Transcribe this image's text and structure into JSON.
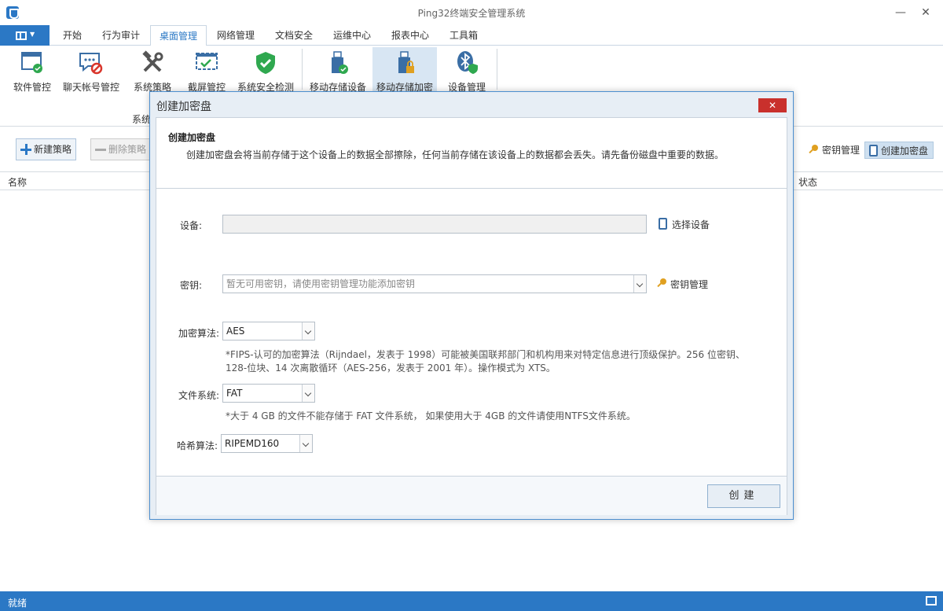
{
  "window": {
    "title": "Ping32终端安全管理系统"
  },
  "menu": {
    "tabs": [
      "开始",
      "行为审计",
      "桌面管理",
      "网络管理",
      "文档安全",
      "运维中心",
      "报表中心",
      "工具箱"
    ],
    "active_index": 2
  },
  "ribbon": {
    "buttons": [
      "软件管控",
      "聊天帐号管控",
      "系统策略",
      "截屏管控",
      "系统安全检测",
      "移动存储设备",
      "移动存储加密",
      "设备管理"
    ],
    "group_label": "系统"
  },
  "toolbar": {
    "new_policy": "新建策略",
    "delete_policy": "删除策略",
    "key_manage": "密钥管理",
    "create_encrypted_disk": "创建加密盘"
  },
  "table": {
    "columns": [
      "名称",
      "状态"
    ]
  },
  "status": {
    "text": "就绪"
  },
  "dialog": {
    "title": "创建加密盘",
    "close": "✕",
    "header_title": "创建加密盘",
    "header_desc": "创建加密盘会将当前存储于这个设备上的数据全部擦除，任何当前存储在该设备上的数据都会丢失。请先备份磁盘中重要的数据。",
    "device_label": "设备:",
    "device_value": "",
    "select_device": "选择设备",
    "key_label": "密钥:",
    "key_placeholder": "暂无可用密钥，请使用密钥管理功能添加密钥",
    "key_manage": "密钥管理",
    "algo_label": "加密算法:",
    "algo_value": "AES",
    "algo_note_1": "*FIPS-认可的加密算法（Rijndael，发表于 1998）可能被美国联邦部门和机构用来对特定信息进行顶级保护。256 位密钥、",
    "algo_note_2": "128-位块、14 次离散循环（AES-256，发表于 2001 年）。操作模式为 XTS。",
    "fs_label": "文件系统:",
    "fs_value": "FAT",
    "fs_note": "*大于 4 GB 的文件不能存储于 FAT 文件系统， 如果使用大于 4GB 的文件请使用NTFS文件系统。",
    "hash_label": "哈希算法:",
    "hash_value": "RIPEMD160",
    "create_button": "创建"
  },
  "colors": {
    "accent": "#2b78c5",
    "close": "#c9302c"
  }
}
